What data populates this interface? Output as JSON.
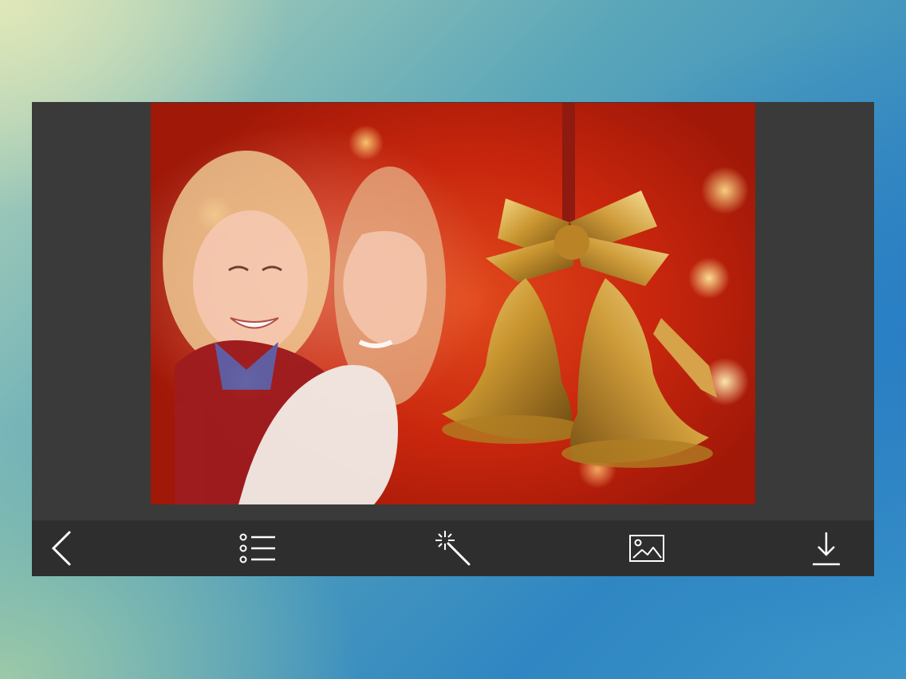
{
  "photo": {
    "subject": "christmas-bells-frame-with-girl-and-woman"
  },
  "toolbar": {
    "icons": [
      "back-icon",
      "list-icon",
      "magic-wand-icon",
      "image-icon",
      "download-icon"
    ]
  },
  "colors": {
    "screen_bg": "#3a3a3a",
    "toolbar_bg": "#2e2e2e",
    "icon_color": "#ffffff",
    "frame_red": "#c8260d",
    "bell_gold": "#c9952f"
  }
}
